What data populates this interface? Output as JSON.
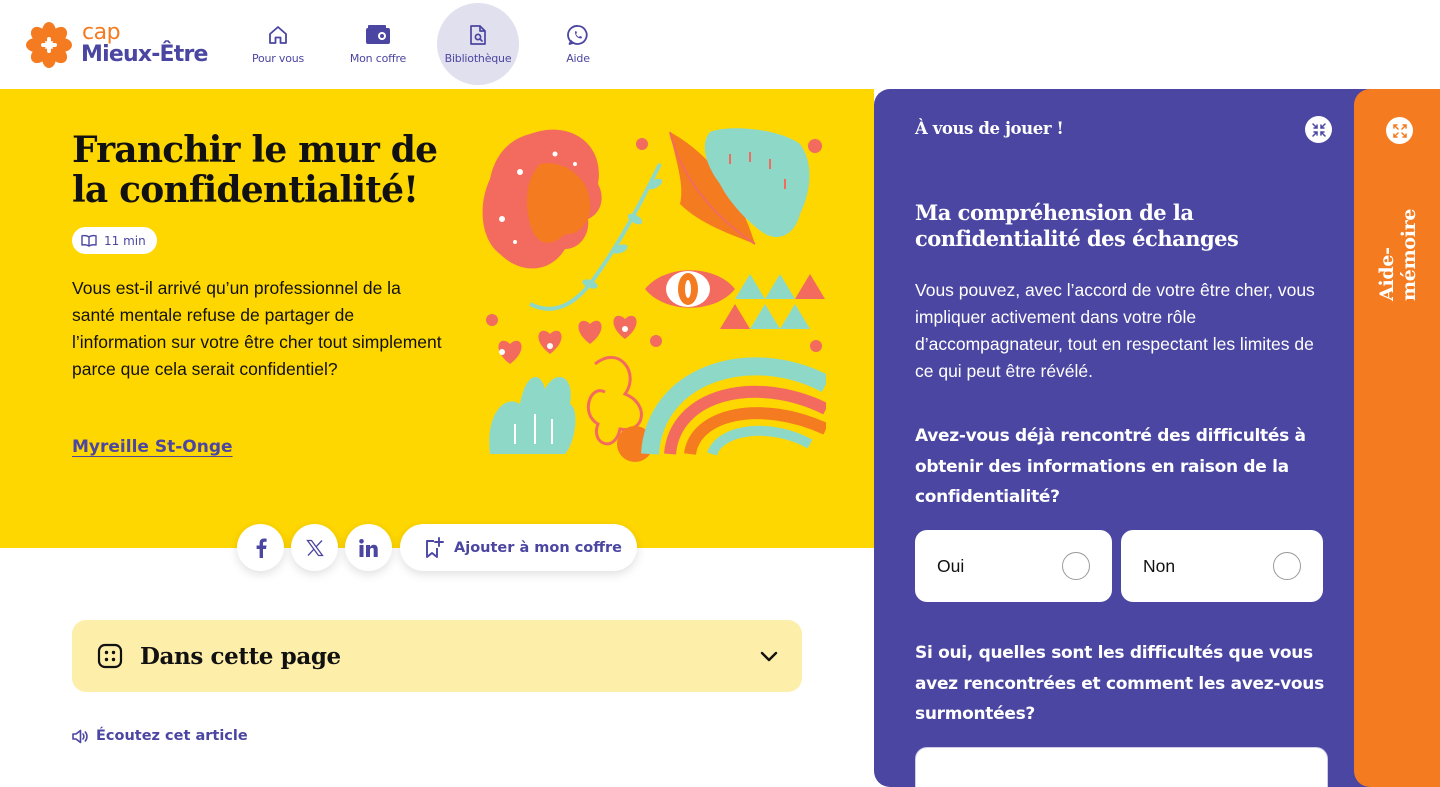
{
  "brand": {
    "cap": "cap",
    "name": "Mieux-Être",
    "accent": "#f47b20",
    "primary": "#4b46a1"
  },
  "nav": [
    {
      "label": "Pour vous",
      "icon": "home-icon",
      "active": false
    },
    {
      "label": "Mon coffre",
      "icon": "vault-icon",
      "active": false
    },
    {
      "label": "Bibliothèque",
      "icon": "library-document-icon",
      "active": true
    },
    {
      "label": "Aide",
      "icon": "chat-phone-icon",
      "active": false
    }
  ],
  "article": {
    "title": "Franchir le mur de la confidentialité!",
    "read_time": "11 min",
    "intro": "Vous est-il arrivé qu’un professionnel de la santé mentale refuse de partager de l’information sur votre être cher tout simplement parce que cela serait confidentiel?",
    "author": "Myreille St-Onge",
    "hero_color": "#ffd700"
  },
  "share": {
    "facebook": "facebook-icon",
    "x": "x-icon",
    "linkedin": "linkedin-icon",
    "save_label": "Ajouter à mon coffre"
  },
  "toc": {
    "title": "Dans cette page"
  },
  "listen": {
    "label": "Écoutez cet article"
  },
  "panel": {
    "header": "À vous de jouer !",
    "title": "Ma compréhension de la confidentialité des échanges",
    "text": "Vous pouvez, avec l’accord de votre être cher, vous impliquer activement dans votre rôle d’accompagnateur, tout en respectant les limites de ce qui peut être révélé.",
    "question1": "Avez-vous déjà rencontré des difficultés à obtenir des informations en raison de la confidentialité?",
    "options": [
      "Oui",
      "Non"
    ],
    "question2": "Si oui, quelles sont les difficultés que vous avez rencontrées et comment les avez-vous surmontées?",
    "answer_value": ""
  },
  "sidetab": {
    "label": "Aide-mémoire"
  }
}
